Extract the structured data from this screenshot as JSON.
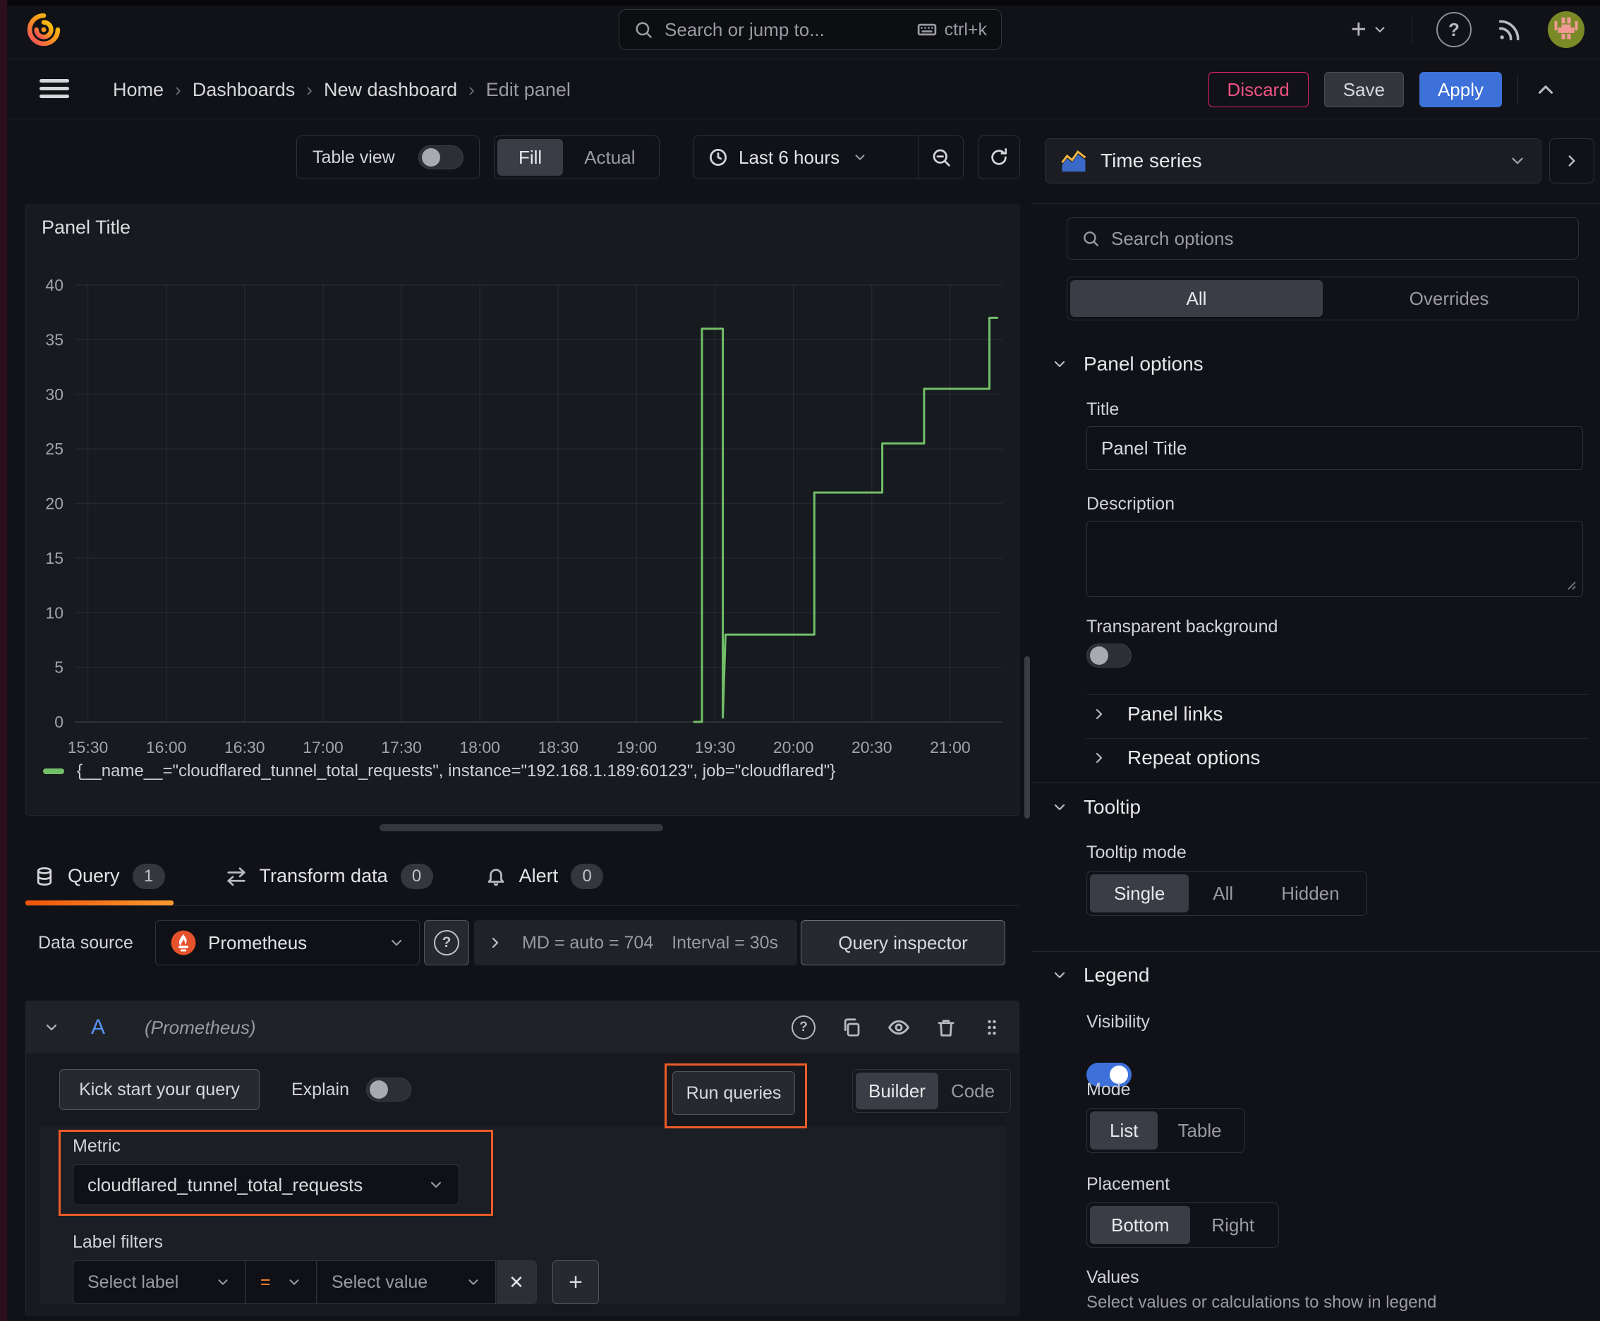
{
  "topbar": {
    "search_placeholder": "Search or jump to...",
    "search_shortcut": "ctrl+k"
  },
  "breadcrumb": {
    "items": [
      "Home",
      "Dashboards",
      "New dashboard",
      "Edit panel"
    ],
    "separator": "›"
  },
  "header_actions": {
    "discard": "Discard",
    "save": "Save",
    "apply": "Apply"
  },
  "view_toolbar": {
    "table_view_label": "Table view",
    "fill_label": "Fill",
    "actual_label": "Actual",
    "time_range": "Last 6 hours"
  },
  "panel": {
    "title": "Panel Title"
  },
  "chart_data": {
    "type": "line",
    "step": true,
    "title": "Panel Title",
    "xlabel": "",
    "ylabel": "",
    "grid": true,
    "legend_position": "bottom",
    "x_axis": {
      "origin_time": "15:25",
      "domain_minutes": [
        0,
        355
      ],
      "tick_labels": [
        "15:30",
        "16:00",
        "16:30",
        "17:00",
        "17:30",
        "18:00",
        "18:30",
        "19:00",
        "19:30",
        "20:00",
        "20:30",
        "21:00"
      ],
      "tick_minutes": [
        5,
        35,
        65,
        95,
        125,
        155,
        185,
        215,
        245,
        275,
        305,
        335
      ]
    },
    "y_axis": {
      "ticks": [
        0,
        5,
        10,
        15,
        20,
        25,
        30,
        35,
        40
      ],
      "lim": [
        0,
        40
      ]
    },
    "series": [
      {
        "name": "{__name__=\"cloudflared_tunnel_total_requests\", instance=\"192.168.1.189:60123\", job=\"cloudflared\"}",
        "color": "#73bf69",
        "points": [
          [
            237,
            0
          ],
          [
            240,
            0
          ],
          [
            240,
            36
          ],
          [
            248,
            36
          ],
          [
            248,
            0.4
          ],
          [
            249,
            8
          ],
          [
            283,
            8
          ],
          [
            283,
            21
          ],
          [
            309,
            21
          ],
          [
            309,
            25.5
          ],
          [
            325,
            25.5
          ],
          [
            325,
            30.5
          ],
          [
            350,
            30.5
          ],
          [
            350,
            37
          ],
          [
            353,
            37
          ]
        ]
      }
    ]
  },
  "editor_tabs": {
    "query": {
      "label": "Query",
      "badge": "1"
    },
    "transform": {
      "label": "Transform data",
      "badge": "0"
    },
    "alert": {
      "label": "Alert",
      "badge": "0"
    }
  },
  "datasource_bar": {
    "label": "Data source",
    "datasource": "Prometheus",
    "max_data_points": "MD = auto = 704",
    "interval": "Interval = 30s",
    "query_inspector": "Query inspector"
  },
  "query_editor": {
    "ref_id": "A",
    "datasource_hint": "(Prometheus)",
    "kick_start": "Kick start your query",
    "explain": "Explain",
    "run_queries": "Run queries",
    "builder": "Builder",
    "code": "Code",
    "metric_label": "Metric",
    "metric_value": "cloudflared_tunnel_total_requests",
    "label_filters_label": "Label filters",
    "select_label_placeholder": "Select label",
    "operator": "=",
    "select_value_placeholder": "Select value",
    "remove": "✕",
    "add": "+"
  },
  "options_pane": {
    "visualization": "Time series",
    "search_placeholder": "Search options",
    "filter_tabs": {
      "all": "All",
      "overrides": "Overrides"
    },
    "panel_options": {
      "heading": "Panel options",
      "title_label": "Title",
      "title_value": "Panel Title",
      "description_label": "Description",
      "transparent_label": "Transparent background"
    },
    "collapsed": {
      "panel_links": "Panel links",
      "repeat_options": "Repeat options"
    },
    "tooltip": {
      "heading": "Tooltip",
      "mode_label": "Tooltip mode",
      "modes": [
        "Single",
        "All",
        "Hidden"
      ],
      "selected": "Single"
    },
    "legend": {
      "heading": "Legend",
      "visibility_label": "Visibility",
      "mode_label": "Mode",
      "modes": [
        "List",
        "Table"
      ],
      "selected_mode": "List",
      "placement_label": "Placement",
      "placements": [
        "Bottom",
        "Right"
      ],
      "selected_placement": "Bottom",
      "values_label": "Values",
      "values_hint": "Select values or calculations to show in legend"
    }
  },
  "colors": {
    "canvas": "#111217",
    "panel": "#171a1f",
    "accent_orange": "#ee5b28",
    "series_green": "#73bf69",
    "primary_blue": "#3d71d9",
    "destructive_pink": "#e0226e",
    "text": "#ccccdc",
    "text_dim": "#9a9aa2"
  }
}
